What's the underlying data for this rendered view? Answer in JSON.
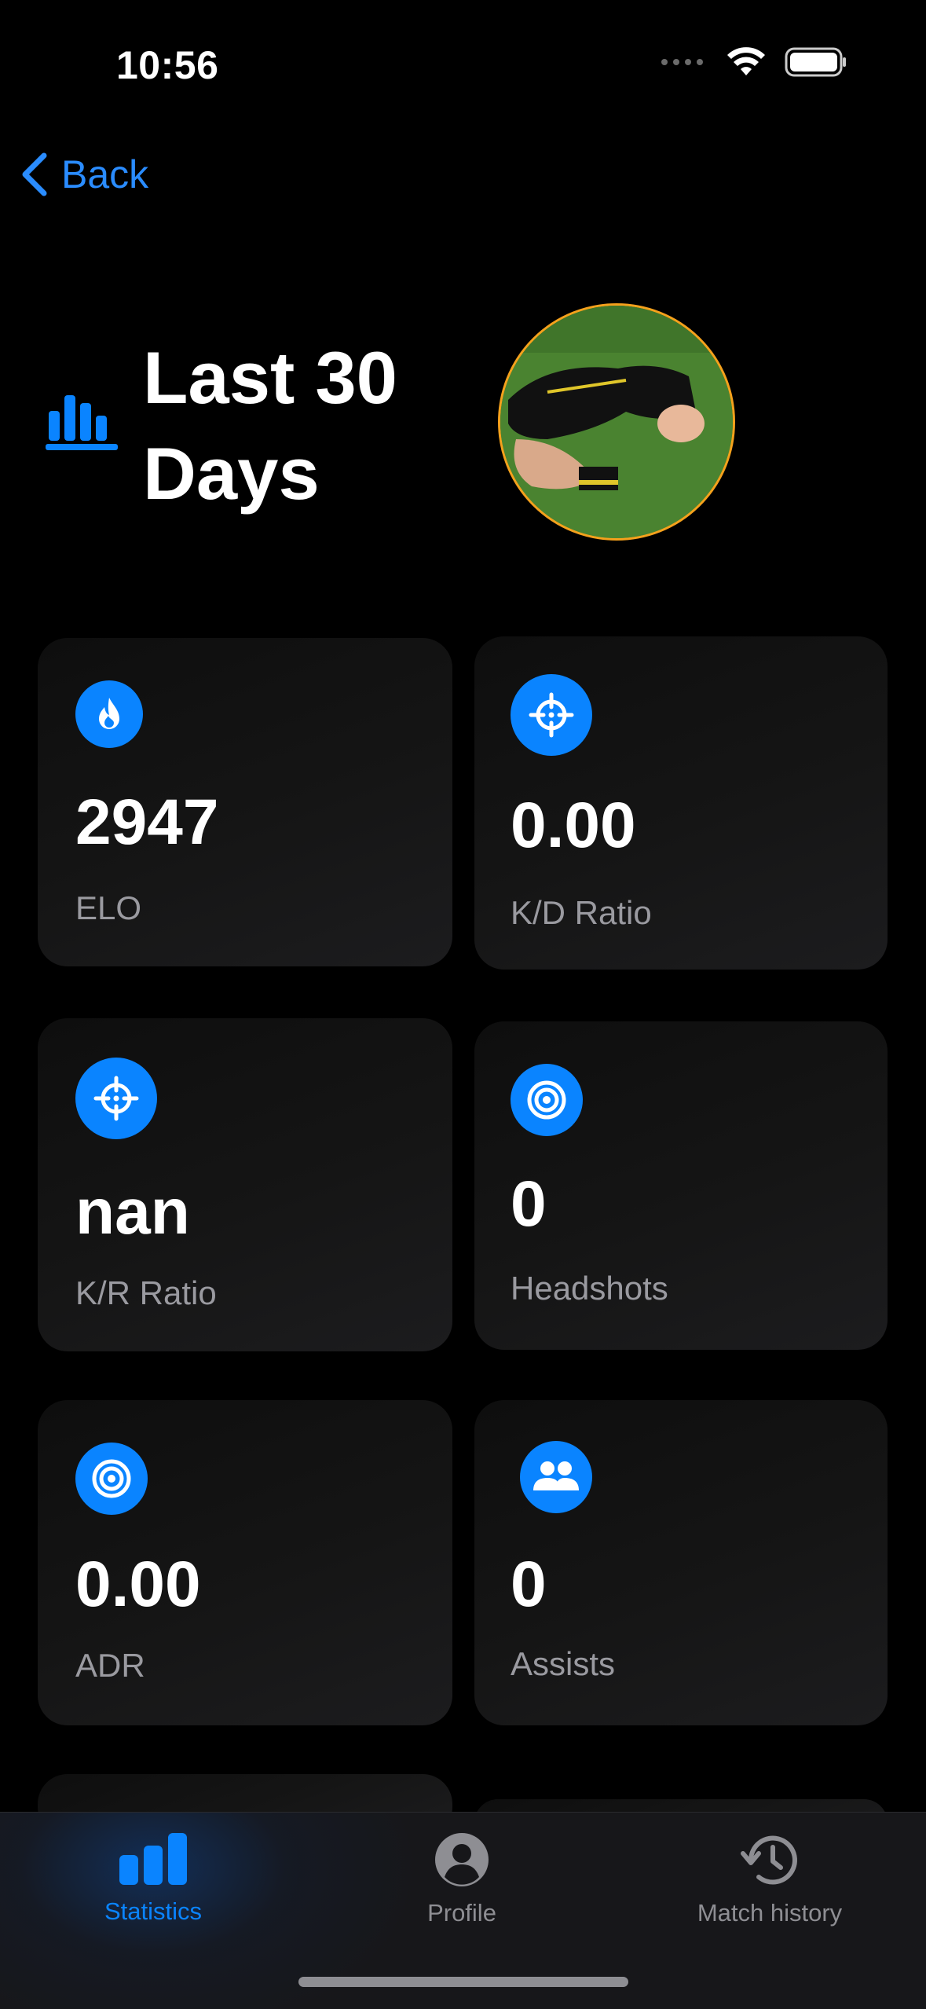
{
  "status_bar": {
    "time": "10:56"
  },
  "nav": {
    "back_label": "Back"
  },
  "header": {
    "title": "Last 30 Days"
  },
  "stats": [
    {
      "value": "2947",
      "label": "ELO",
      "icon": "flame-icon"
    },
    {
      "value": "0.00",
      "label": "K/D Ratio",
      "icon": "crosshair-icon"
    },
    {
      "value": "nan",
      "label": "K/R Ratio",
      "icon": "crosshair-icon"
    },
    {
      "value": "0",
      "label": "Headshots",
      "icon": "target-icon"
    },
    {
      "value": "0.00",
      "label": "ADR",
      "icon": "target-icon"
    },
    {
      "value": "0",
      "label": "Assists",
      "icon": "people-icon"
    }
  ],
  "tabbar": {
    "statistics": "Statistics",
    "profile": "Profile",
    "match_history": "Match history"
  },
  "colors": {
    "accent": "#0a84ff",
    "avatar_border": "#f5a11c",
    "background": "#000000"
  }
}
